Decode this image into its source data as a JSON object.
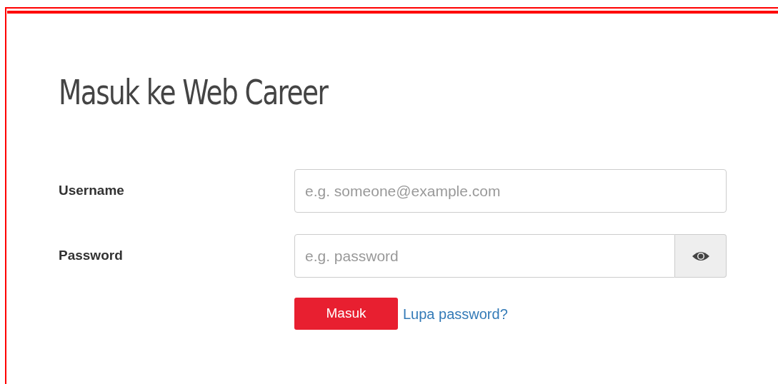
{
  "title": "Masuk ke Web Career",
  "fields": [
    {
      "label": "Username",
      "placeholder": "e.g. someone@example.com",
      "kind": "text"
    },
    {
      "label": "Password",
      "placeholder": "e.g. password",
      "kind": "password"
    }
  ],
  "submit_button": "Masuk",
  "forgot_link": "Lupa password?"
}
